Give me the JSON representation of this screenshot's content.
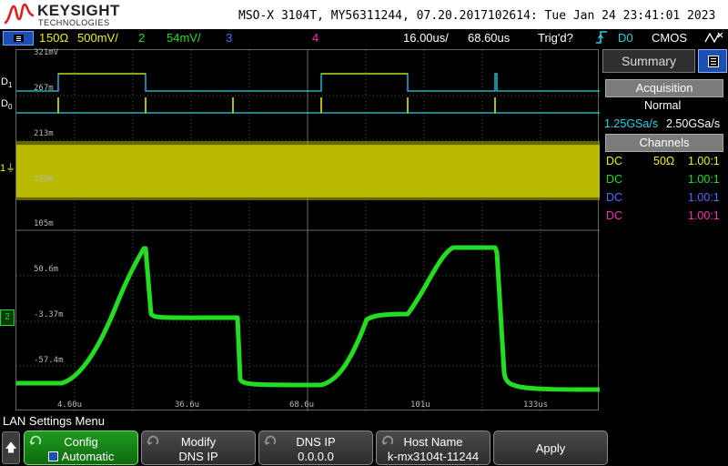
{
  "header": {
    "brand": "KEYSIGHT",
    "brand_sub": "TECHNOLOGIES",
    "title_line": "MSO-X 3104T, MY56311244, 07.20.2017102614: Tue Jan 24 23:41:01 2023"
  },
  "status_bar": {
    "ch1_label": "1",
    "ch1_impedance": "50Ω",
    "ch1_scale": "500mV/",
    "ch2_label": "2",
    "ch2_scale": "54mV/",
    "ch3_label": "3",
    "ch4_label": "4",
    "timebase": "16.00us/",
    "delay": "68.60us",
    "trigger_status": "Trig'd?",
    "trigger_source": "D0",
    "logic_family": "CMOS"
  },
  "graticule": {
    "y_labels": [
      "321mV",
      "267m",
      "213m",
      "159m",
      "105m",
      "50.6m",
      "-3.37m",
      "-57.4m"
    ],
    "x_labels": [
      "4.60u",
      "36.6u",
      "68.6u",
      "101u",
      "133us"
    ],
    "digital_labels": [
      {
        "name": "D",
        "index": "1"
      },
      {
        "name": "D",
        "index": "0"
      }
    ],
    "ch2_marker": "2",
    "ch1_marker": "1"
  },
  "side_panel": {
    "tab_label": "Summary",
    "acquisition_header": "Acquisition",
    "acquisition_mode": "Normal",
    "sample_rate_1": "1.25GSa/s",
    "sample_rate_2": "2.50GSa/s",
    "channels_header": "Channels",
    "channels": [
      {
        "coupling": "DC",
        "impedance": "50Ω",
        "probe": "1.00:1",
        "color": "#f0f000"
      },
      {
        "coupling": "DC",
        "impedance": "",
        "probe": "1.00:1",
        "color": "#22dd22"
      },
      {
        "coupling": "DC",
        "impedance": "",
        "probe": "1.00:1",
        "color": "#4d6bff"
      },
      {
        "coupling": "DC",
        "impedance": "",
        "probe": "1.00:1",
        "color": "#ff2ab8"
      }
    ]
  },
  "softkeys": {
    "menu_title": "LAN Settings Menu",
    "keys": [
      {
        "line1": "Config",
        "line2": "Automatic"
      },
      {
        "line1": "Modify",
        "line2": "DNS IP"
      },
      {
        "line1": "DNS IP",
        "line2": "0.0.0.0"
      },
      {
        "line1": "Host Name",
        "line2": "k-mx3104t-11244"
      },
      {
        "line1": "Apply",
        "line2": ""
      }
    ]
  },
  "colors": {
    "ch1": "#f0f000",
    "ch2": "#22dd22",
    "ch3": "#4d6bff",
    "ch4": "#ff2ab8",
    "digital": "#26d4e6",
    "active_softkey": "#1f9a1f"
  },
  "icons": {
    "menu": "menu-list-icon",
    "summary": "summary-list-icon",
    "trigger": "rising-edge-icon",
    "logic": "trigger-mode-icon",
    "up": "up-arrow-icon",
    "knob": "rotate-knob-icon"
  }
}
